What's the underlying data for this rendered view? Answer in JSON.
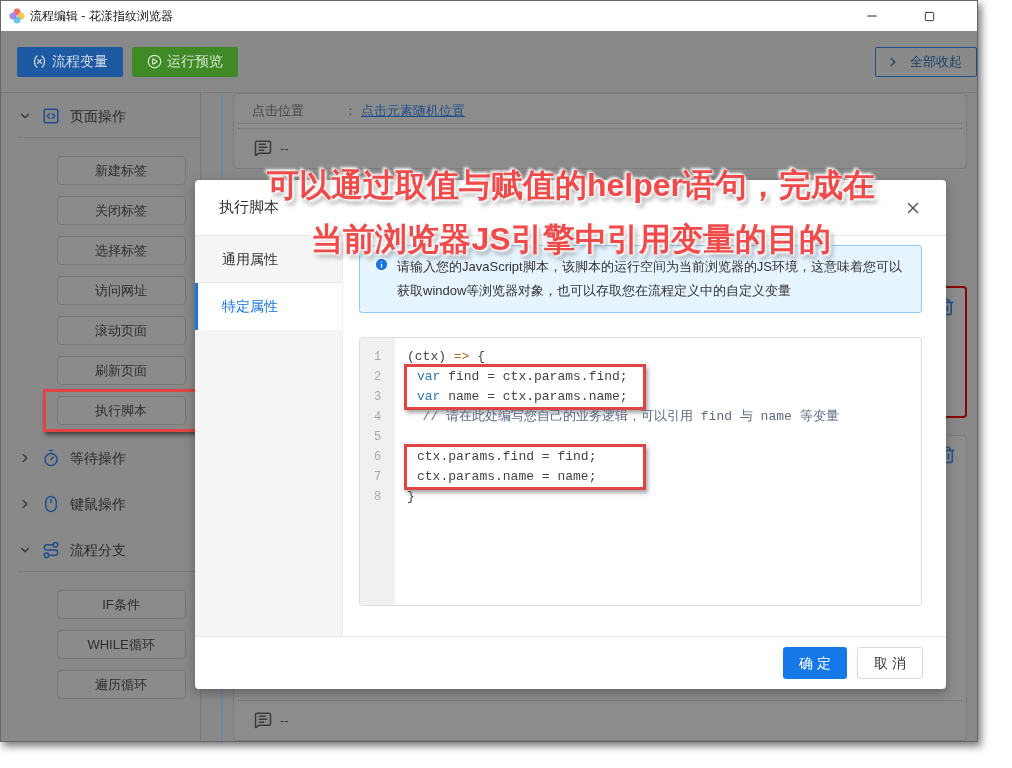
{
  "window": {
    "title": "流程编辑 - 花漾指纹浏览器"
  },
  "toolbar": {
    "buttons": [
      {
        "label": "流程变量",
        "kind": "variables"
      },
      {
        "label": "运行预览",
        "kind": "preview"
      }
    ],
    "collapse_button": "全部收起"
  },
  "sidebar": {
    "groups": [
      {
        "label": "页面操作",
        "kind": "page",
        "expanded": true,
        "items": [
          {
            "label": "新建标签",
            "annotated": false
          },
          {
            "label": "关闭标签",
            "annotated": false
          },
          {
            "label": "选择标签",
            "annotated": false
          },
          {
            "label": "访问网址",
            "annotated": false
          },
          {
            "label": "滚动页面",
            "annotated": false
          },
          {
            "label": "刷新页面",
            "annotated": false
          },
          {
            "label": "执行脚本",
            "annotated": true
          }
        ]
      },
      {
        "label": "等待操作",
        "kind": "wait",
        "expanded": false
      },
      {
        "label": "键鼠操作",
        "kind": "mouse",
        "expanded": false
      },
      {
        "label": "流程分支",
        "kind": "branch",
        "expanded": true,
        "items": [
          {
            "label": "IF条件",
            "annotated": false
          },
          {
            "label": "WHILE循环",
            "annotated": false
          },
          {
            "label": "遍历循环",
            "annotated": false
          }
        ]
      }
    ]
  },
  "canvas": {
    "cards": [
      {
        "selected": false,
        "field_label": "点击位置",
        "separator": "：",
        "field_value": "点击元素随机位置",
        "comment": "--"
      },
      {
        "selected": true
      },
      {
        "selected": false,
        "comment": "--"
      }
    ]
  },
  "dialog": {
    "title": "执行脚本",
    "tabs": [
      {
        "label": "通用属性",
        "selected": false
      },
      {
        "label": "特定属性",
        "selected": true
      }
    ],
    "alert": "请输入您的JavaScript脚本，该脚本的运行空间为当前浏览器的JS环境，这意味着您可以获取window等浏览器对象，也可以存取您在流程定义中的自定义变量",
    "code": [
      {
        "no": "1",
        "boxed": false,
        "tokens": [
          {
            "text": "(ctx) ",
            "kind": "plain"
          },
          {
            "text": "=>",
            "kind": "operator"
          },
          {
            "text": " {",
            "kind": "plain"
          }
        ]
      },
      {
        "no": "2",
        "boxed": true,
        "tokens": [
          {
            "text": "var",
            "kind": "keyword"
          },
          {
            "text": " find = ctx.params.find;",
            "kind": "plain"
          }
        ]
      },
      {
        "no": "3",
        "boxed": true,
        "tokens": [
          {
            "text": "var",
            "kind": "keyword"
          },
          {
            "text": " name = ctx.params.name;",
            "kind": "plain"
          }
        ]
      },
      {
        "no": "4",
        "boxed": false,
        "tokens": [
          {
            "text": "  // 请在此处编写您自己的业务逻辑，可以引用 find 与 name 等变量",
            "kind": "comment"
          }
        ]
      },
      {
        "no": "5",
        "boxed": false
      },
      {
        "no": "6",
        "boxed": true,
        "tokens": [
          {
            "text": "ctx.params.find = find;",
            "kind": "plain"
          }
        ]
      },
      {
        "no": "7",
        "boxed": true,
        "tokens": [
          {
            "text": "ctx.params.name = name;",
            "kind": "plain"
          }
        ]
      },
      {
        "no": "8",
        "boxed": false,
        "tokens": [
          {
            "text": "}",
            "kind": "plain"
          }
        ]
      }
    ],
    "buttons": [
      {
        "label": "确 定",
        "kind": "primary"
      },
      {
        "label": "取 消",
        "kind": "default"
      }
    ]
  },
  "annotation": {
    "lines": [
      "可以通过取值与赋值的helper语句，完成在",
      "当前浏览器JS引擎中引用变量的目的"
    ]
  }
}
